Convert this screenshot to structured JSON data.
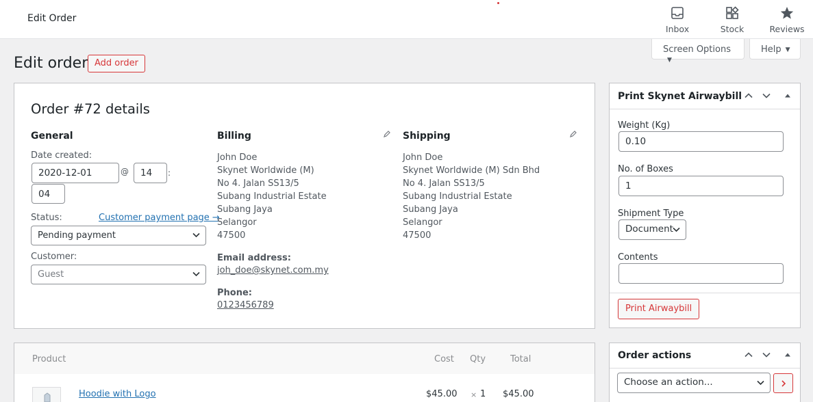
{
  "topbar": {
    "title": "Edit Order",
    "items": [
      {
        "label": "Inbox",
        "icon": "inbox-icon"
      },
      {
        "label": "Stock",
        "icon": "stock-icon"
      },
      {
        "label": "Reviews",
        "icon": "star-icon"
      }
    ]
  },
  "screen_options": {
    "label": "Screen Options"
  },
  "help": {
    "label": "Help"
  },
  "page": {
    "title": "Edit order",
    "add_order_label": "Add order"
  },
  "order": {
    "heading": "Order #72 details",
    "general": {
      "heading": "General",
      "date_created_label": "Date created:",
      "date_value": "2020-12-01",
      "at_label": "@",
      "hour_value": "14",
      "colon": ":",
      "minute_value": "04",
      "status_label": "Status:",
      "customer_payment_link": "Customer payment page →",
      "status_value": "Pending payment",
      "customer_label": "Customer:",
      "customer_value": "Guest"
    },
    "billing": {
      "heading": "Billing",
      "lines": [
        "John Doe",
        "Skynet Worldwide (M)",
        "No 4. Jalan SS13/5",
        "Subang Industrial Estate",
        "Subang Jaya",
        "Selangor",
        "47500"
      ],
      "email_label": "Email address:",
      "email": "joh_doe@skynet.com.my",
      "phone_label": "Phone:",
      "phone": "0123456789"
    },
    "shipping": {
      "heading": "Shipping",
      "lines": [
        "John Doe",
        "Skynet Worldwide (M) Sdn Bhd",
        "No 4. Jalan SS13/5",
        "Subang Industrial Estate",
        "Subang Jaya",
        "Selangor",
        "47500"
      ]
    }
  },
  "items": {
    "headers": {
      "product": "Product",
      "cost": "Cost",
      "qty": "Qty",
      "total": "Total"
    },
    "rows": [
      {
        "product": "Hoodie with Logo",
        "cost": "$45.00",
        "qty_x": "×",
        "qty": "1",
        "total": "$45.00"
      }
    ]
  },
  "airwaybill": {
    "title": "Print Skynet Airwaybill",
    "weight_label": "Weight (Kg)",
    "weight_value": "0.10",
    "boxes_label": "No. of Boxes",
    "boxes_value": "1",
    "shipment_type_label": "Shipment Type",
    "shipment_type_value": "Document",
    "contents_label": "Contents",
    "contents_value": "",
    "print_label": "Print Airwaybill"
  },
  "order_actions": {
    "title": "Order actions",
    "select_value": "Choose an action..."
  },
  "colors": {
    "accent": "#d63638",
    "link": "#2271b1"
  }
}
